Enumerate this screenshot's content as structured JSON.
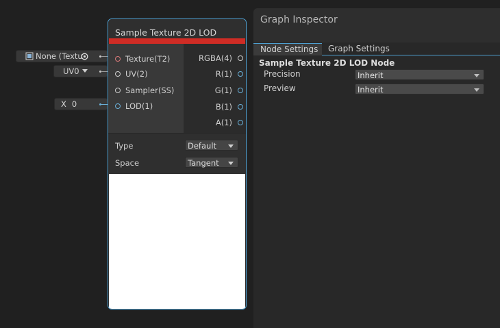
{
  "colors": {
    "accent": "#4e9fd0",
    "node_header_bar": "#cf2c25",
    "canvas_bg": "#202020"
  },
  "inline_inputs": {
    "texture": {
      "icon": "texture-icon",
      "value": "None (Textu",
      "picker_icon": "object-picker-icon"
    },
    "uv": {
      "value": "UV0"
    },
    "lod": {
      "axis_label": "X",
      "value": "0"
    }
  },
  "node": {
    "title": "Sample Texture 2D LOD",
    "inputs": [
      {
        "label": "Texture(T2)"
      },
      {
        "label": "UV(2)"
      },
      {
        "label": "Sampler(SS)"
      },
      {
        "label": "LOD(1)"
      }
    ],
    "outputs": [
      {
        "label": "RGBA(4)"
      },
      {
        "label": "R(1)"
      },
      {
        "label": "G(1)"
      },
      {
        "label": "B(1)"
      },
      {
        "label": "A(1)"
      }
    ],
    "settings": {
      "type_label": "Type",
      "type_value": "Default",
      "space_label": "Space",
      "space_value": "Tangent"
    }
  },
  "inspector": {
    "title": "Graph Inspector",
    "tabs": [
      {
        "label": "Node Settings",
        "active": true
      },
      {
        "label": "Graph Settings",
        "active": false
      }
    ],
    "section_title": "Sample Texture 2D LOD Node",
    "fields": [
      {
        "label": "Precision",
        "value": "Inherit"
      },
      {
        "label": "Preview",
        "value": "Inherit"
      }
    ]
  }
}
